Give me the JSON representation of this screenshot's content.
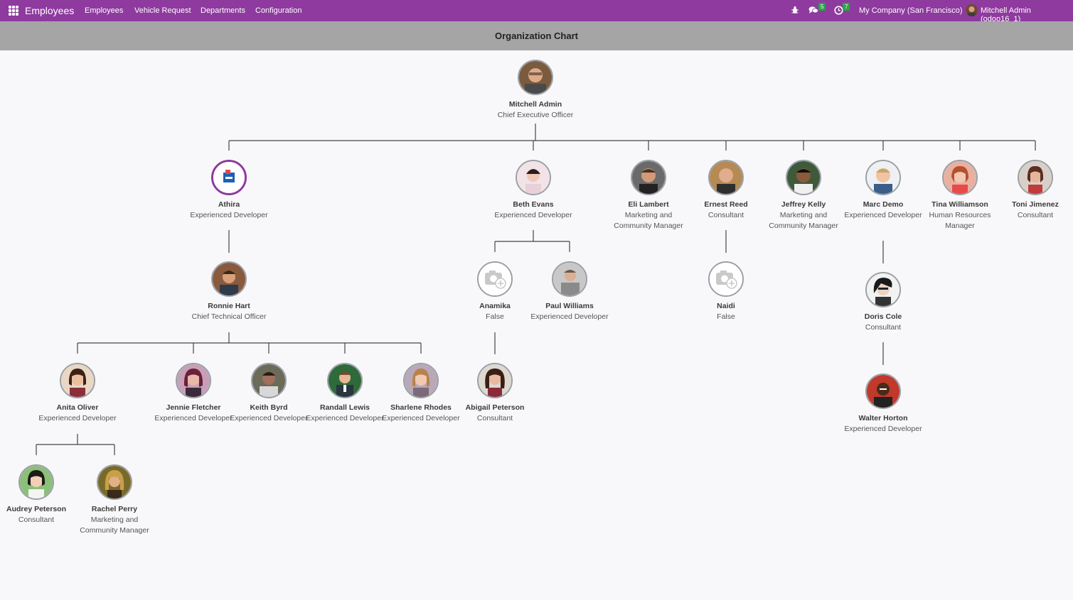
{
  "topbar": {
    "app_name": "Employees",
    "menu": [
      "Employees",
      "Vehicle Request",
      "Departments",
      "Configuration"
    ],
    "messages_count": "5",
    "activities_count": "7",
    "company": "My Company (San Francisco)",
    "user": "Mitchell Admin (odoo16_1)",
    "color": "#8e3a9e"
  },
  "page_title": "Organization Chart",
  "employees": {
    "mitchell": {
      "name": "Mitchell Admin",
      "job": "Chief Executive Officer"
    },
    "athira": {
      "name": "Athira",
      "job": "Experienced Developer"
    },
    "beth": {
      "name": "Beth Evans",
      "job": "Experienced Developer"
    },
    "eli": {
      "name": "Eli Lambert",
      "job": "Marketing and Community Manager"
    },
    "ernest": {
      "name": "Ernest Reed",
      "job": "Consultant"
    },
    "jeffrey": {
      "name": "Jeffrey Kelly",
      "job": "Marketing and Community Manager"
    },
    "marc": {
      "name": "Marc Demo",
      "job": "Experienced Developer"
    },
    "tina": {
      "name": "Tina Williamson",
      "job": "Human Resources Manager"
    },
    "toni": {
      "name": "Toni Jimenez",
      "job": "Consultant"
    },
    "ronnie": {
      "name": "Ronnie Hart",
      "job": "Chief Technical Officer"
    },
    "anamika": {
      "name": "Anamika",
      "job": "False"
    },
    "paul": {
      "name": "Paul Williams",
      "job": "Experienced Developer"
    },
    "naidi": {
      "name": "Naidi",
      "job": "False"
    },
    "doris": {
      "name": "Doris Cole",
      "job": "Consultant"
    },
    "anita": {
      "name": "Anita Oliver",
      "job": "Experienced Developer"
    },
    "jennie": {
      "name": "Jennie Fletcher",
      "job": "Experienced Developer"
    },
    "keith": {
      "name": "Keith Byrd",
      "job": "Experienced Developer"
    },
    "randall": {
      "name": "Randall Lewis",
      "job": "Experienced Developer"
    },
    "sharlene": {
      "name": "Sharlene Rhodes",
      "job": "Experienced Developer"
    },
    "abigail": {
      "name": "Abigail Peterson",
      "job": "Consultant"
    },
    "walter": {
      "name": "Walter Horton",
      "job": "Experienced Developer"
    },
    "audrey": {
      "name": "Audrey Peterson",
      "job": "Consultant"
    },
    "rachel": {
      "name": "Rachel Perry",
      "job": "Marketing and Community Manager"
    }
  }
}
